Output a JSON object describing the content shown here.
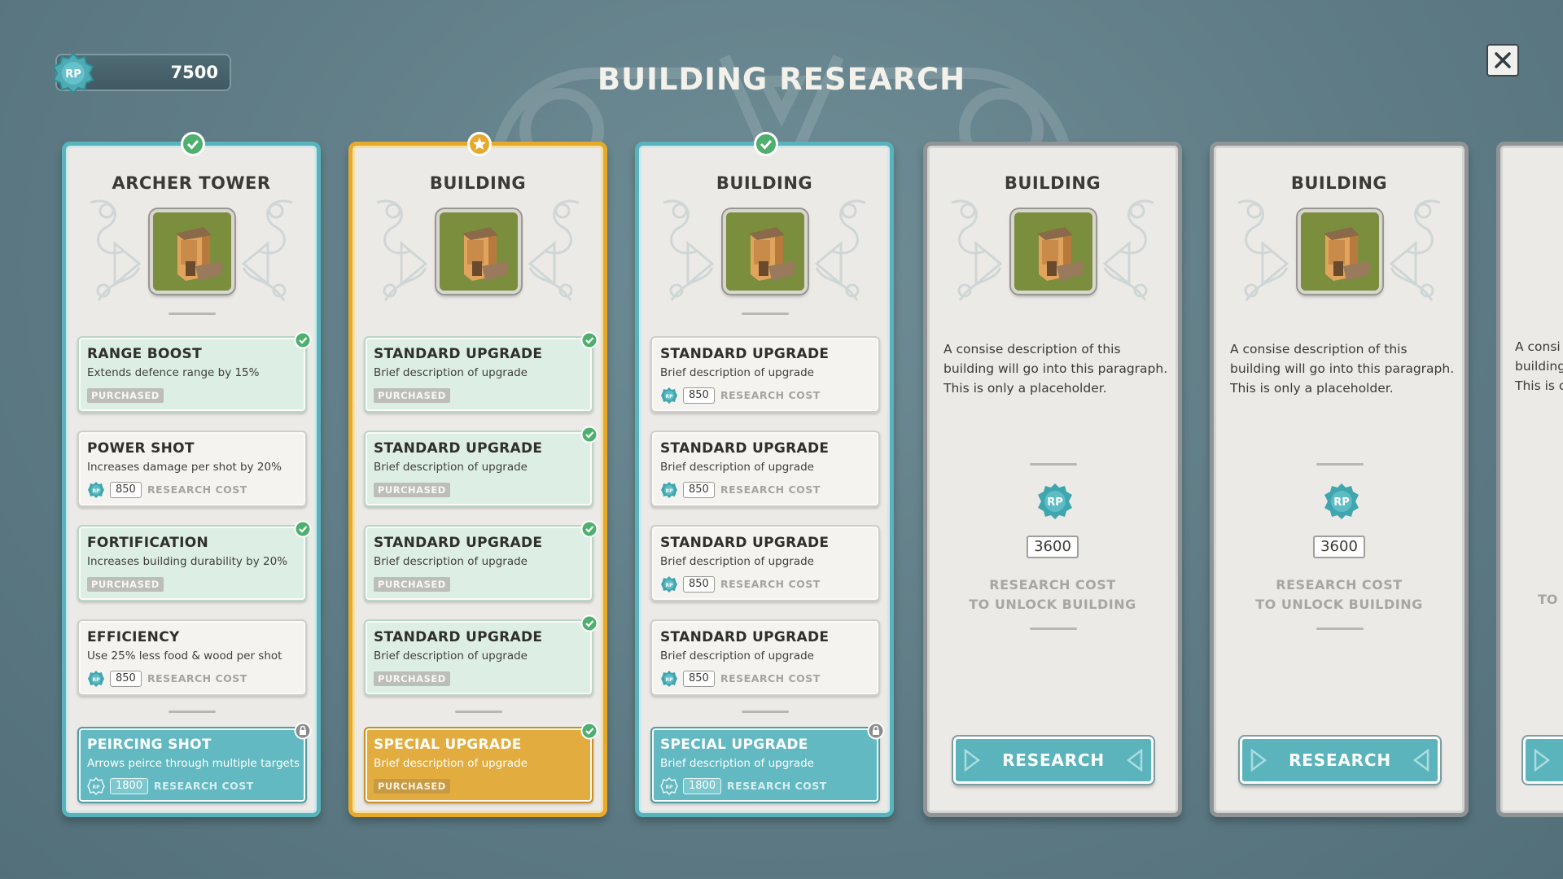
{
  "title": "BUILDING RESEARCH",
  "rp_balance": "7500",
  "rp_badge_label": "RP",
  "colors": {
    "teal": "#58b3bc",
    "gold": "#e6a92c",
    "grey": "#8f9496",
    "background": "#5f7c86"
  },
  "cards": [
    {
      "title": "ARCHER TOWER",
      "status": "completed",
      "upgrades": [
        {
          "name": "RANGE BOOST",
          "desc": "Extends defence range by 15%",
          "state": "purchased",
          "tag": "PURCHASED"
        },
        {
          "name": "POWER SHOT",
          "desc": "Increases damage per shot by 20%",
          "state": "available",
          "cost": "850",
          "cost_label": "RESEARCH COST"
        },
        {
          "name": "FORTIFICATION",
          "desc": "Increases building durability by 20%",
          "state": "purchased",
          "tag": "PURCHASED"
        },
        {
          "name": "EFFICIENCY",
          "desc": "Use 25% less food & wood per shot",
          "state": "available",
          "cost": "850",
          "cost_label": "RESEARCH COST"
        }
      ],
      "special": {
        "name": "PEIRCING SHOT",
        "desc": "Arrows peirce through multiple targets",
        "state": "locked",
        "cost": "1800",
        "cost_label": "RESEARCH COST"
      }
    },
    {
      "title": "BUILDING",
      "status": "starred",
      "upgrades": [
        {
          "name": "STANDARD UPGRADE",
          "desc": "Brief description of upgrade",
          "state": "purchased",
          "tag": "PURCHASED"
        },
        {
          "name": "STANDARD UPGRADE",
          "desc": "Brief description of upgrade",
          "state": "purchased",
          "tag": "PURCHASED"
        },
        {
          "name": "STANDARD UPGRADE",
          "desc": "Brief description of upgrade",
          "state": "purchased",
          "tag": "PURCHASED"
        },
        {
          "name": "STANDARD UPGRADE",
          "desc": "Brief description of upgrade",
          "state": "purchased",
          "tag": "PURCHASED"
        }
      ],
      "special": {
        "name": "SPECIAL UPGRADE",
        "desc": "Brief description of upgrade",
        "state": "purchased",
        "tag": "PURCHASED"
      }
    },
    {
      "title": "BUILDING",
      "status": "completed",
      "upgrades": [
        {
          "name": "STANDARD UPGRADE",
          "desc": "Brief description of upgrade",
          "state": "available",
          "cost": "850",
          "cost_label": "RESEARCH COST"
        },
        {
          "name": "STANDARD UPGRADE",
          "desc": "Brief description of upgrade",
          "state": "available",
          "cost": "850",
          "cost_label": "RESEARCH COST"
        },
        {
          "name": "STANDARD UPGRADE",
          "desc": "Brief description of upgrade",
          "state": "available",
          "cost": "850",
          "cost_label": "RESEARCH COST"
        },
        {
          "name": "STANDARD UPGRADE",
          "desc": "Brief description of upgrade",
          "state": "available",
          "cost": "850",
          "cost_label": "RESEARCH COST"
        }
      ],
      "special": {
        "name": "SPECIAL UPGRADE",
        "desc": "Brief description of upgrade",
        "state": "locked",
        "cost": "1800",
        "cost_label": "RESEARCH COST"
      }
    },
    {
      "title": "BUILDING",
      "status": "locked",
      "description_lines": [
        "A consise description of  this",
        "building will go into this paragraph.",
        "This is only a placeholder."
      ],
      "unlock_cost": "3600",
      "unlock_label_lines": [
        "RESEARCH COST",
        "TO UNLOCK BUILDING"
      ],
      "button_label": "RESEARCH"
    },
    {
      "title": "BUILDING",
      "status": "locked",
      "description_lines": [
        "A consise description of  this",
        "building will go into this paragraph.",
        "This is only a placeholder."
      ],
      "unlock_cost": "3600",
      "unlock_label_lines": [
        "RESEARCH COST",
        "TO UNLOCK BUILDING"
      ],
      "button_label": "RESEARCH"
    }
  ],
  "partial_card": {
    "desc_fragments": [
      "A consi",
      "building",
      "This is c"
    ],
    "label_fragment": "TO"
  }
}
